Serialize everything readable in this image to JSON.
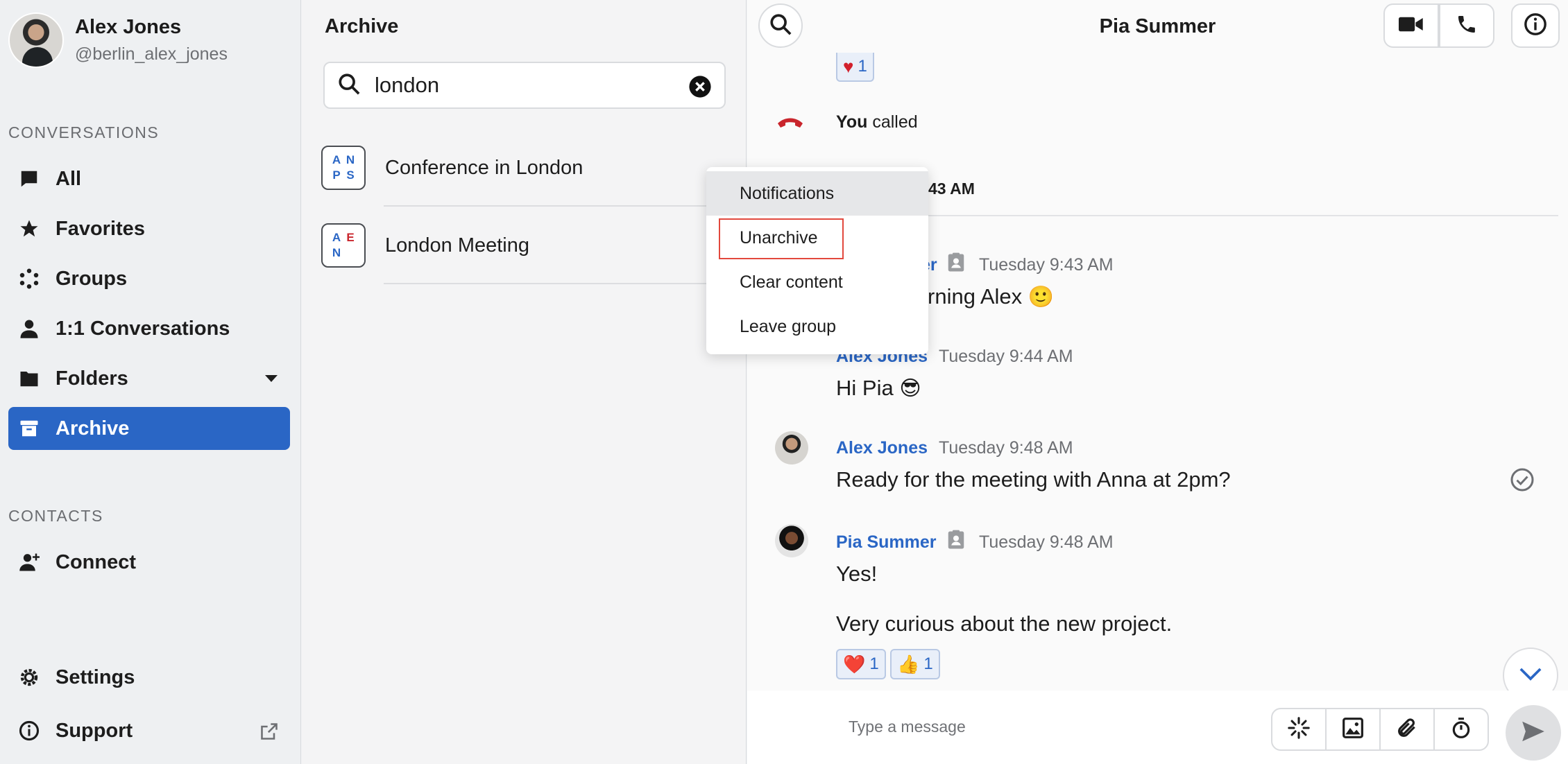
{
  "profile": {
    "name": "Alex Jones",
    "handle": "@berlin_alex_jones"
  },
  "sidebar": {
    "conversations_label": "CONVERSATIONS",
    "items": [
      {
        "label": "All",
        "icon": "chat-bubble-icon"
      },
      {
        "label": "Favorites",
        "icon": "star-icon"
      },
      {
        "label": "Groups",
        "icon": "groups-dots-icon"
      },
      {
        "label": "1:1 Conversations",
        "icon": "person-icon"
      },
      {
        "label": "Folders",
        "icon": "folder-icon"
      },
      {
        "label": "Archive",
        "icon": "archive-box-icon",
        "active": true
      }
    ],
    "contacts_label": "CONTACTS",
    "connect_label": "Connect",
    "settings_label": "Settings",
    "support_label": "Support"
  },
  "middle": {
    "title": "Archive",
    "search": {
      "value": "london",
      "placeholder": "Search"
    },
    "conversations": [
      {
        "name": "Conference in London",
        "initials": [
          "A",
          "N",
          "P",
          "S"
        ]
      },
      {
        "name": "London Meeting",
        "initials": [
          "A",
          "E",
          "N"
        ]
      }
    ]
  },
  "chat": {
    "title": "Pia Summer",
    "top_reaction_count": "1",
    "call_line": {
      "actor": "You",
      "action": "called"
    },
    "date_fragment": "43 AM",
    "messages": [
      {
        "sender": "Pia Summer",
        "time": "Tuesday 9:43 AM",
        "text": "Good morning Alex",
        "visible_sender": "er",
        "visible_text": "rning Alex",
        "emoji": "🙂"
      },
      {
        "sender": "Alex Jones",
        "time": "Tuesday 9:44 AM",
        "text": "Hi Pia",
        "emoji": "😎"
      },
      {
        "sender": "Alex Jones",
        "time": "Tuesday 9:48 AM",
        "text": "Ready for the meeting with Anna at 2pm?"
      },
      {
        "sender": "Pia Summer",
        "time": "Tuesday 9:48 AM",
        "text": "Yes!",
        "text2": "Very curious about the new project."
      }
    ],
    "bottom_reactions": [
      {
        "emoji": "❤️",
        "count": "1"
      },
      {
        "emoji": "👍",
        "count": "1"
      }
    ],
    "composer_placeholder": "Type a message"
  },
  "context_menu": {
    "items": [
      "Notifications",
      "Unarchive",
      "Clear content",
      "Leave group"
    ],
    "hovered": "Notifications",
    "highlighted": "Unarchive"
  },
  "colors": {
    "accent": "#2a66c5",
    "highlight_border": "#e2483d",
    "call_red": "#c9252c"
  }
}
